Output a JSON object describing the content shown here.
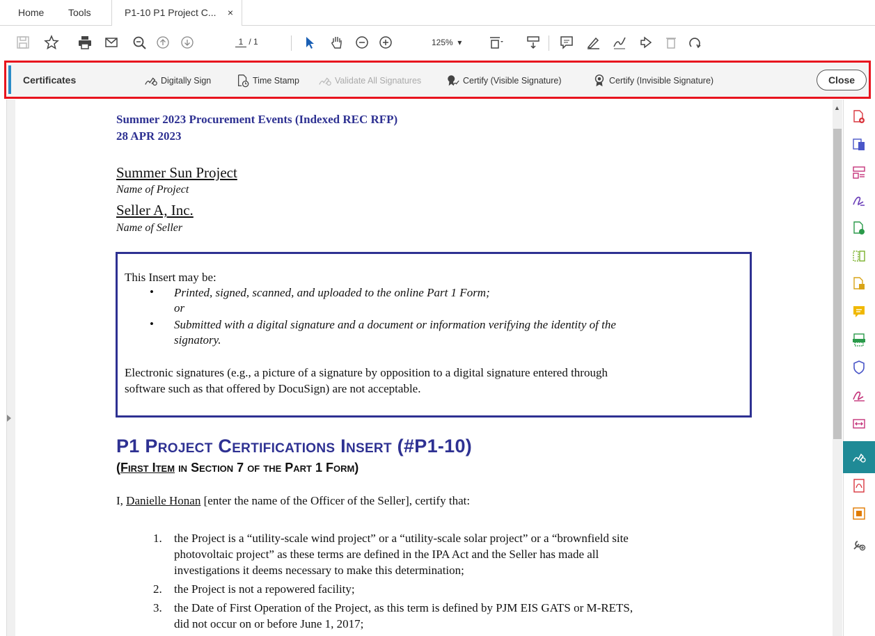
{
  "tabs": {
    "home": "Home",
    "tools": "Tools",
    "document": "P1-10 P1 Project C...",
    "close": "×"
  },
  "toolbar": {
    "page_current": "1",
    "page_total": "/ 1",
    "zoom": "125%",
    "zoom_arrow": "▾"
  },
  "certificates": {
    "label": "Certificates",
    "digitally_sign": "Digitally Sign",
    "time_stamp": "Time Stamp",
    "validate_all": "Validate All Signatures",
    "certify_visible": "Certify (Visible Signature)",
    "certify_invisible": "Certify (Invisible Signature)",
    "close": "Close"
  },
  "document": {
    "heading1": "Summer 2023 Procurement Events (Indexed REC RFP)",
    "heading2": "28 APR 2023",
    "project_name": "Summer Sun Project",
    "project_caption": "Name of Project",
    "seller_name": "Seller A, Inc.",
    "seller_caption": "Name of Seller",
    "box": {
      "intro": "This Insert may be:",
      "bullet1": "Printed, signed, scanned, and uploaded to the online Part 1 Form;",
      "or": "or",
      "bullet2_line1": "Submitted with a digital signature and a document or information verifying the identity of the",
      "bullet2_line2": "signatory.",
      "note_line1": "Electronic signatures (e.g., a picture of a signature by opposition to a digital signature entered through",
      "note_line2": "software such as that offered by DocuSign) are not acceptable."
    },
    "title": "P1 Project Certifications Insert (#P1-10)",
    "subtitle_underlined": "First Item",
    "subtitle_rest": " in Section 7 of the Part 1 Form)",
    "subtitle_open": "(",
    "cert_prefix": "I, ",
    "officer_name": "Danielle Honan",
    "cert_suffix": " [enter the name of the Officer of the Seller], certify that:",
    "items": [
      {
        "num": "1.",
        "lines": [
          "the Project is a “utility-scale wind project” or a “utility-scale solar project” or a “brownfield site",
          "photovoltaic project” as these terms are defined in the IPA Act and the Seller has made all",
          "investigations it deems necessary to make this determination;"
        ]
      },
      {
        "num": "2.",
        "lines": [
          "the Project is not a repowered facility;"
        ]
      },
      {
        "num": "3.",
        "lines": [
          "the Date of First Operation of the Project, as this term is defined by PJM EIS GATS or M-RETS,",
          "did not occur on or before June 1, 2017;"
        ]
      }
    ]
  },
  "colors": {
    "accent": "#2e3192",
    "highlight": "#e8141e",
    "active_panel": "#1f8a96"
  }
}
